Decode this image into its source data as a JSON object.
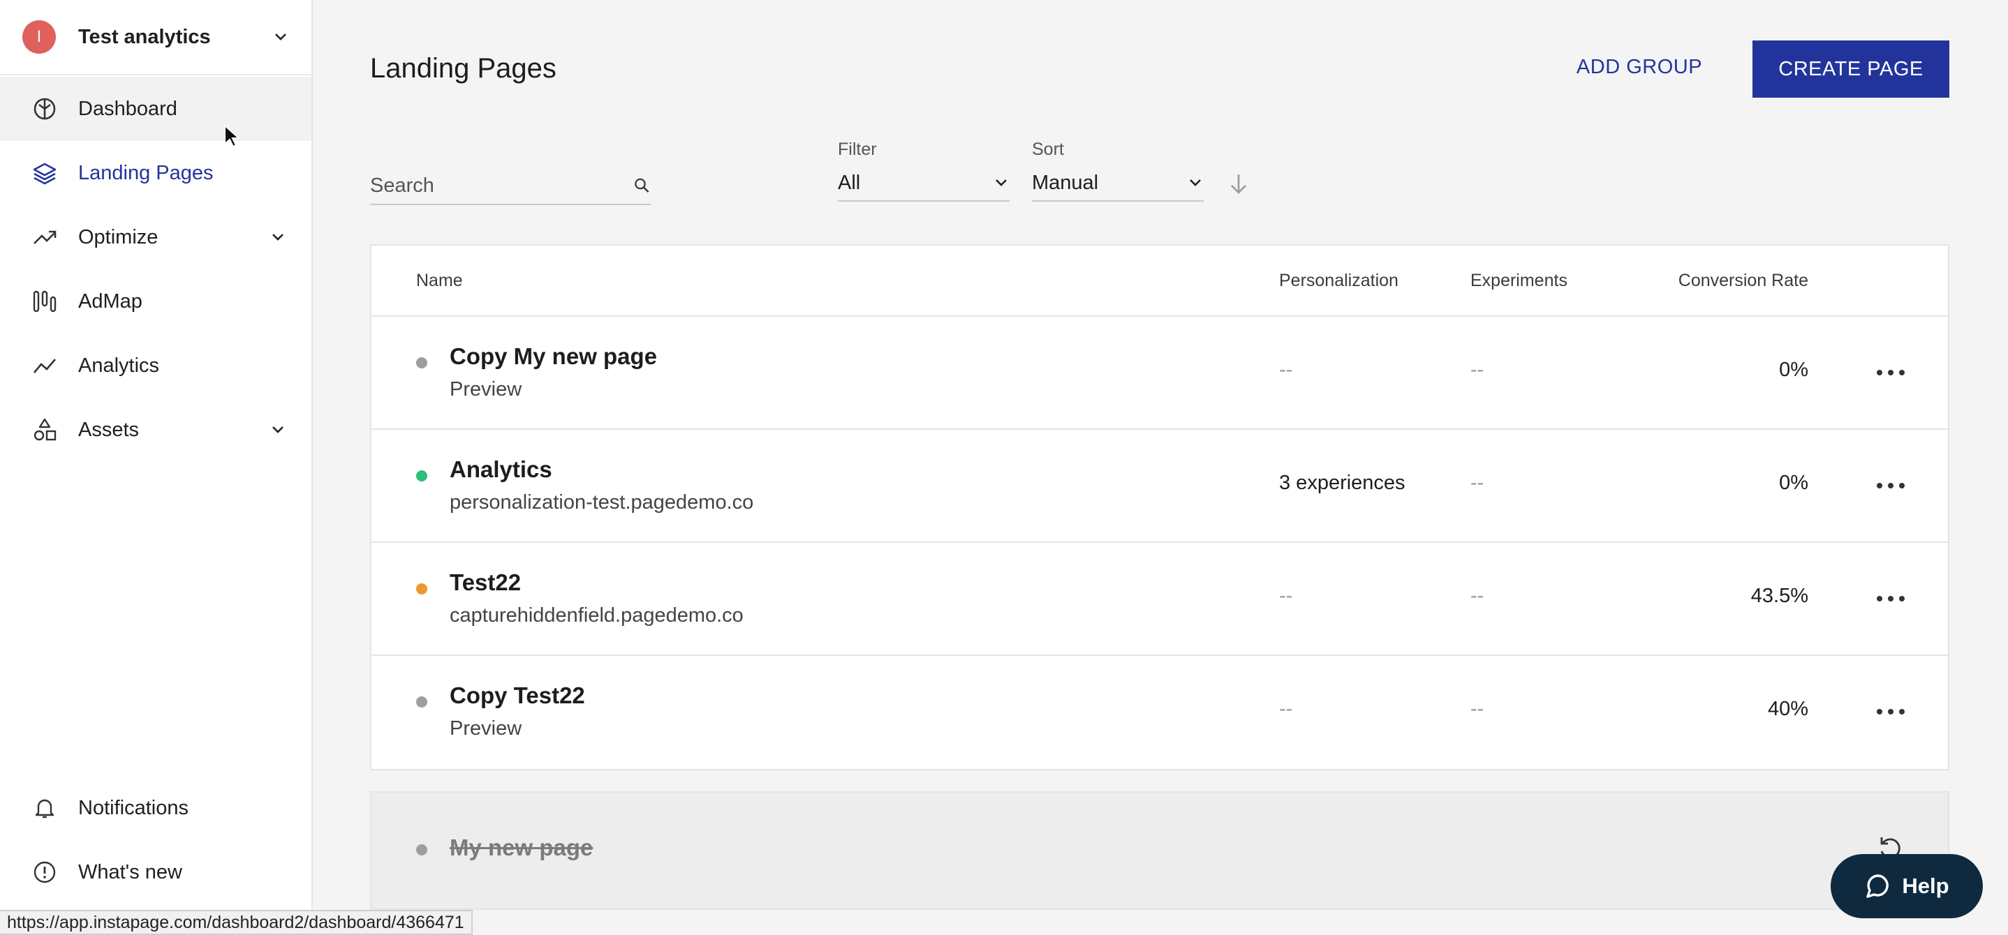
{
  "workspace": {
    "initial": "I",
    "name": "Test analytics"
  },
  "nav": {
    "items": [
      {
        "label": "Dashboard",
        "icon": "dashboard-icon"
      },
      {
        "label": "Landing Pages",
        "icon": "layers-icon",
        "active": true
      },
      {
        "label": "Optimize",
        "icon": "trend-up-icon",
        "expandable": true
      },
      {
        "label": "AdMap",
        "icon": "admap-icon"
      },
      {
        "label": "Analytics",
        "icon": "analytics-icon"
      },
      {
        "label": "Assets",
        "icon": "assets-icon",
        "expandable": true
      }
    ],
    "bottom": [
      {
        "label": "Notifications",
        "icon": "bell-icon"
      },
      {
        "label": "What's new",
        "icon": "info-icon"
      }
    ]
  },
  "header": {
    "title": "Landing Pages",
    "add_group": "ADD GROUP",
    "create_page": "CREATE PAGE"
  },
  "toolbar": {
    "search_placeholder": "Search",
    "filter_label": "Filter",
    "filter_value": "All",
    "sort_label": "Sort",
    "sort_value": "Manual"
  },
  "table": {
    "columns": [
      "Name",
      "Personalization",
      "Experiments",
      "Conversion Rate"
    ],
    "rows": [
      {
        "title": "Copy My new page",
        "subtitle": "Preview",
        "status_color": "#9e9e9e",
        "personalization": "--",
        "experiments": "--",
        "conversion": "0%"
      },
      {
        "title": "Analytics",
        "subtitle": "personalization-test.pagedemo.co",
        "status_color": "#2ebd7a",
        "personalization": "3 experiences",
        "experiments": "--",
        "conversion": "0%"
      },
      {
        "title": "Test22",
        "subtitle": "capturehiddenfield.pagedemo.co",
        "status_color": "#f0962e",
        "personalization": "--",
        "experiments": "--",
        "conversion": "43.5%"
      },
      {
        "title": "Copy Test22",
        "subtitle": "Preview",
        "status_color": "#9e9e9e",
        "personalization": "--",
        "experiments": "--",
        "conversion": "40%"
      }
    ],
    "archived": {
      "title": "My new page",
      "status_color": "#9e9e9e"
    }
  },
  "help": {
    "label": "Help"
  },
  "statusbar": {
    "url": "https://app.instapage.com/dashboard2/dashboard/4366471"
  },
  "colors": {
    "brand": "#22349b",
    "help_bg": "#0f2a3f"
  }
}
